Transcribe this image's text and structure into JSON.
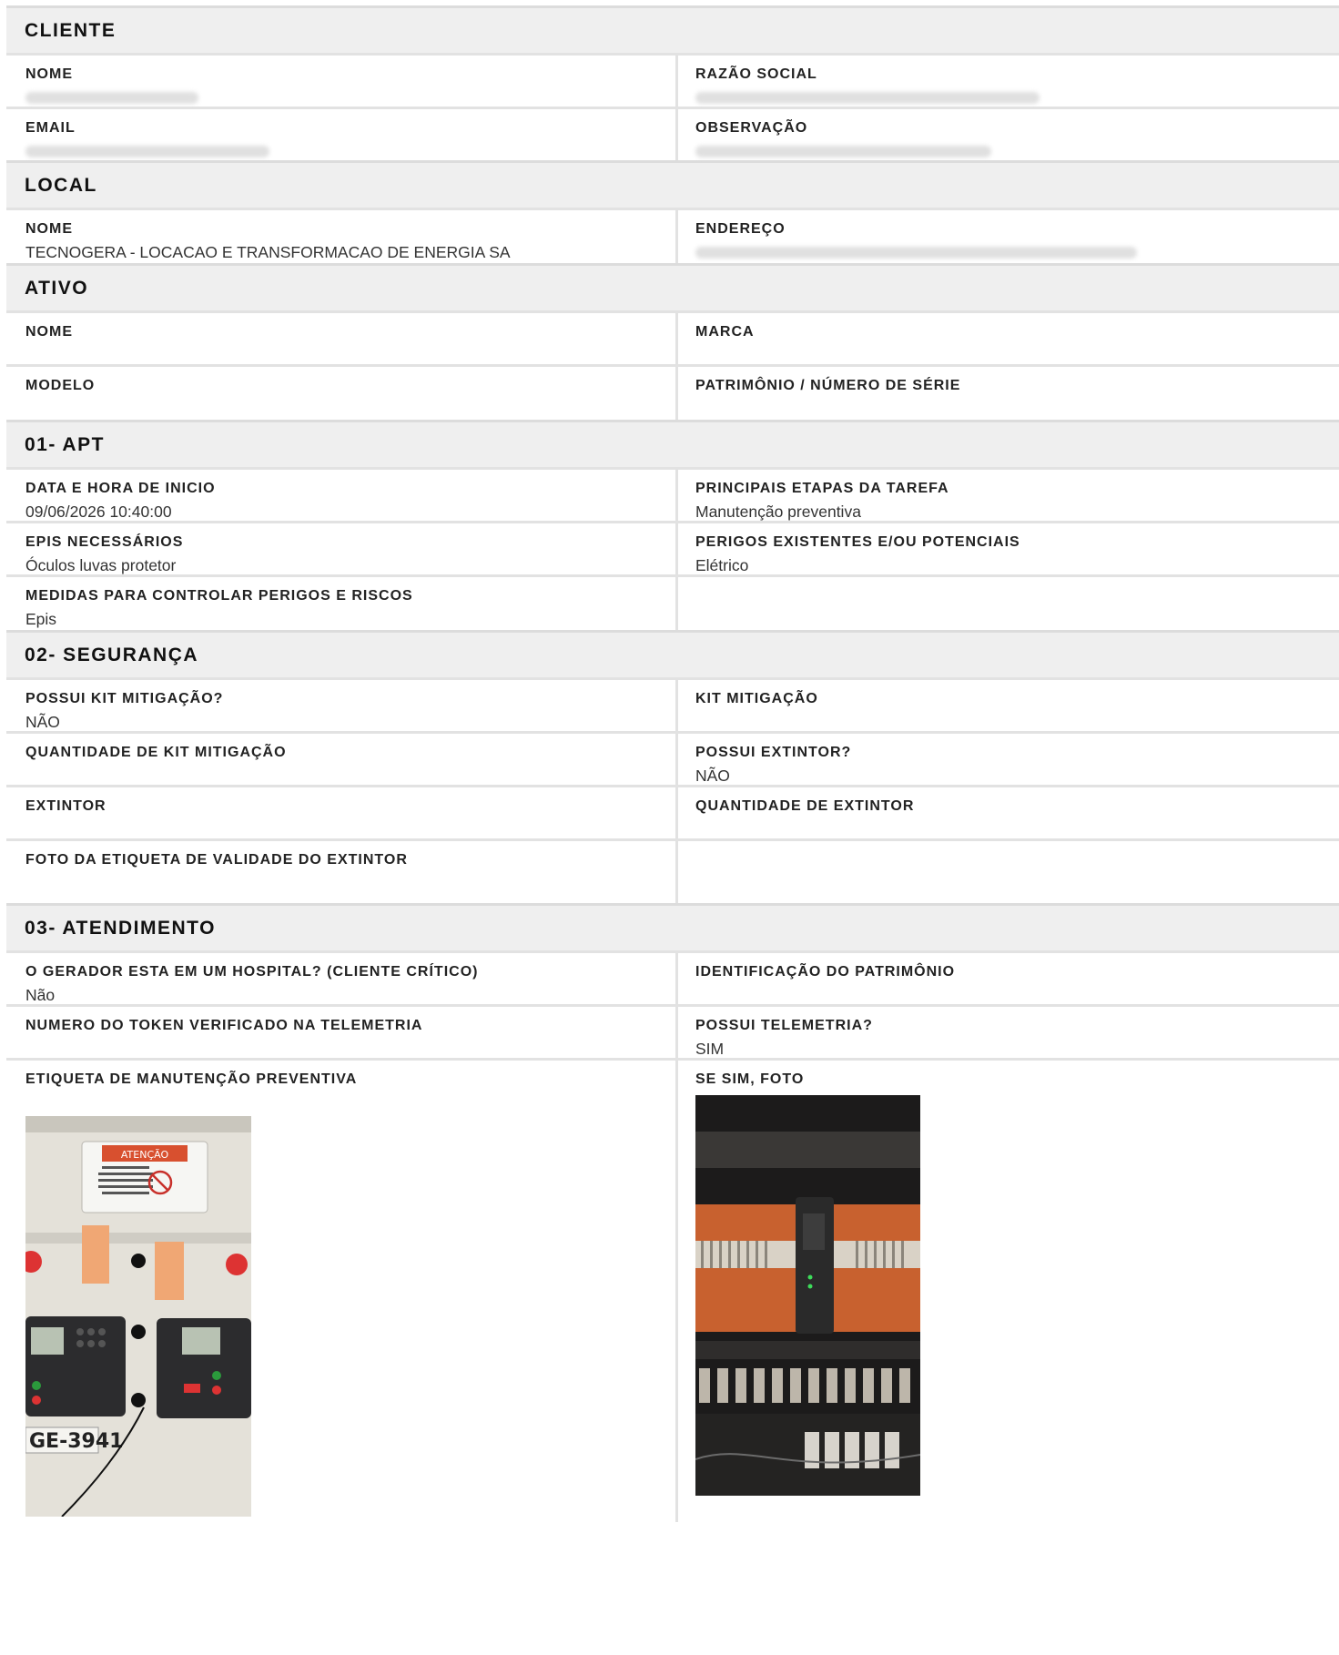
{
  "sections": {
    "cliente": {
      "title": "CLIENTE",
      "nome_label": "NOME",
      "razao_label": "RAZÃO SOCIAL",
      "email_label": "EMAIL",
      "obs_label": "OBSERVAÇÃO"
    },
    "local": {
      "title": "LOCAL",
      "nome_label": "NOME",
      "nome_value": "TECNOGERA - LOCACAO E TRANSFORMACAO DE ENERGIA SA",
      "endereco_label": "ENDEREÇO"
    },
    "ativo": {
      "title": "ATIVO",
      "nome_label": "NOME",
      "marca_label": "MARCA",
      "modelo_label": "MODELO",
      "patrimonio_label": "PATRIMÔNIO / NÚMERO DE SÉRIE"
    },
    "apt": {
      "title": "01- APT",
      "data_label": "DATA E HORA DE INICIO",
      "data_value": "09/06/2026 10:40:00",
      "etapas_label": "PRINCIPAIS ETAPAS DA TAREFA",
      "etapas_value": "Manutenção preventiva",
      "epis_label": "EPIS NECESSÁRIOS",
      "epis_value": "Óculos luvas protetor",
      "perigos_label": "PERIGOS EXISTENTES E/OU POTENCIAIS",
      "perigos_value": "Elétrico",
      "medidas_label": "MEDIDAS PARA CONTROLAR PERIGOS E RISCOS",
      "medidas_value": "Epis"
    },
    "seguranca": {
      "title": "02- SEGURANÇA",
      "possui_kit_label": "POSSUI KIT MITIGAÇÃO?",
      "possui_kit_value": "NÃO",
      "kit_label": "KIT MITIGAÇÃO",
      "qtd_kit_label": "QUANTIDADE DE KIT MITIGAÇÃO",
      "possui_ext_label": "POSSUI EXTINTOR?",
      "possui_ext_value": "NÃO",
      "extintor_label": "EXTINTOR",
      "qtd_ext_label": "QUANTIDADE DE EXTINTOR",
      "foto_label": "FOTO DA ETIQUETA DE VALIDADE DO EXTINTOR"
    },
    "atendimento": {
      "title": "03- ATENDIMENTO",
      "hospital_label": "O GERADOR ESTA EM UM HOSPITAL? (CLIENTE CRÍTICO)",
      "hospital_value": "Não",
      "ident_label": "IDENTIFICAÇÃO DO PATRIMÔNIO",
      "token_label": "NUMERO DO TOKEN VERIFICADO NA TELEMETRIA",
      "telemetria_label": "POSSUI TELEMETRIA?",
      "telemetria_value": "SIM",
      "etiqueta_label": "ETIQUETA DE MANUTENÇÃO PREVENTIVA",
      "foto_label": "SE SIM, FOTO"
    }
  },
  "photo1": {
    "sign_title": "ATENÇÃO",
    "sign_text": "NÃO REALIZAR INTERVENÇÕES NA PARTE INTERNA DESTE PAINEL ENQUANTO ESTIVER ENERGIZADO.",
    "tag": "GE-3941"
  }
}
